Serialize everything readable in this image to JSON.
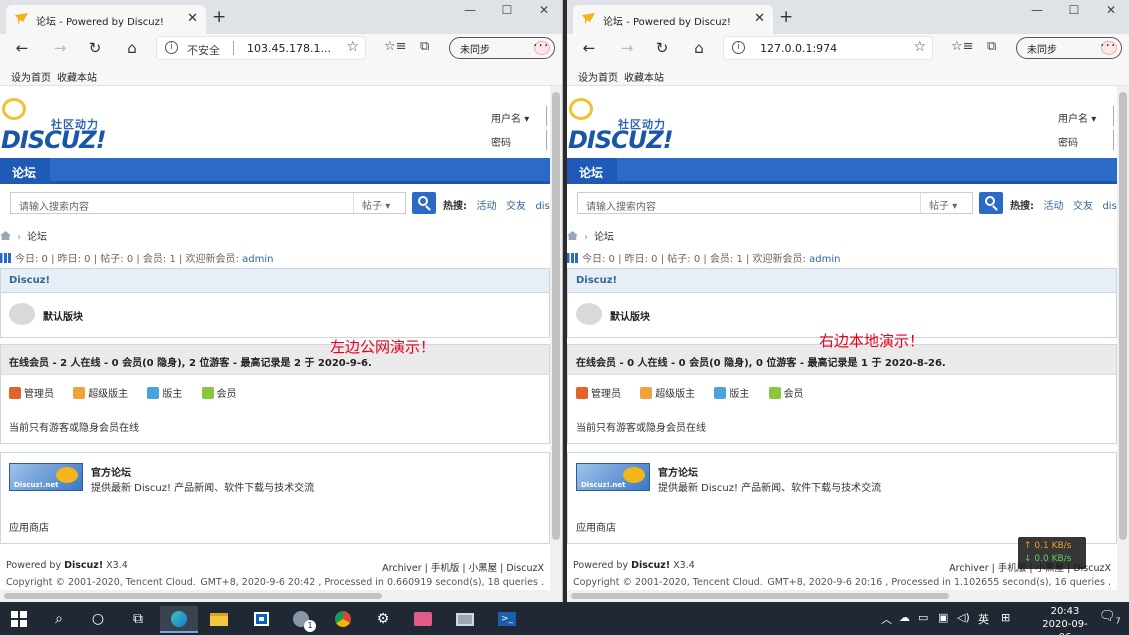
{
  "browser": {
    "tab_title": "论坛 - Powered by Discuz!",
    "new_tab": "+",
    "minimize": "—",
    "maximize": "☐",
    "close": "✕",
    "tab_close": "✕",
    "insecure_label": "不安全",
    "left_url": "103.45.178.1...",
    "right_url": "127.0.0.1:974",
    "sync_label": "未同步",
    "favorites": [
      "设为首页",
      "收藏本站"
    ]
  },
  "site": {
    "slogan": "社区动力",
    "logo_word": "DISCUZ!",
    "username_label": "用户名",
    "username_arrow": "▾",
    "password_label": "密码",
    "nav_item": "论坛",
    "search_placeholder": "请输入搜索内容",
    "search_type": "帖子",
    "search_type_arrow": "▾",
    "hot_label": "热搜:",
    "hot_links": [
      "活动",
      "交友",
      "discu"
    ],
    "breadcrumb": "论坛",
    "stats_prefix": "今日: 0 | 昨日: 0 | 帖子: 0 | 会员: 1 | 欢迎新会员: ",
    "stats_user": "admin",
    "category": "Discuz!",
    "forum_name": "默认版块",
    "legend": [
      "管理员",
      "超级版主",
      "版主",
      "会员"
    ],
    "online_note": "当前只有游客或隐身会员在线",
    "link_badge": "Discuz!.net",
    "link_name": "官方论坛",
    "link_desc": "提供最新 Discuz! 产品新闻、软件下载与技术交流",
    "app_shop": "应用商店",
    "footer_powered_prefix": "Powered by ",
    "footer_powered_name": "Discuz!",
    "footer_version": " X3.4",
    "copyright": "Copyright © 2001-2020, Tencent Cloud."
  },
  "left": {
    "online_title": "在线会员 - 2 人在线 - 0 会员(0 隐身), 2 位游客 - 最高记录是 2 于 2020-9-6.",
    "footer_links": "Archiver | 手机版 | 小黑屋 | DiscuzX",
    "gmt": "GMT+8, 2020-9-6 20:42 , Processed in 0.660919 second(s), 18 queries .",
    "demo_label": "左边公网演示！"
  },
  "right": {
    "online_title": "在线会员 - 0 人在线 - 0 会员(0 隐身), 0 位游客 - 最高记录是 1 于 2020-8-26.",
    "footer_links": "Archiver | 手机版 | 小黑屋 | DiscuzX",
    "gmt": "GMT+8, 2020-9-6 20:16 , Processed in 1.102655 second(s), 16 queries .",
    "demo_label": "右边本地演示！"
  },
  "netmon": {
    "up": "↑ 0.1 KB/s",
    "down": "↓ 0.0 KB/s"
  },
  "taskbar": {
    "ime": "英",
    "time": "20:43",
    "date": "2020-09-06",
    "notify_count": "7",
    "mail_count": "1"
  },
  "colors": {
    "nav_blue": "#2b6ac6",
    "link": "#336699",
    "demo_red": "#e8001c"
  }
}
